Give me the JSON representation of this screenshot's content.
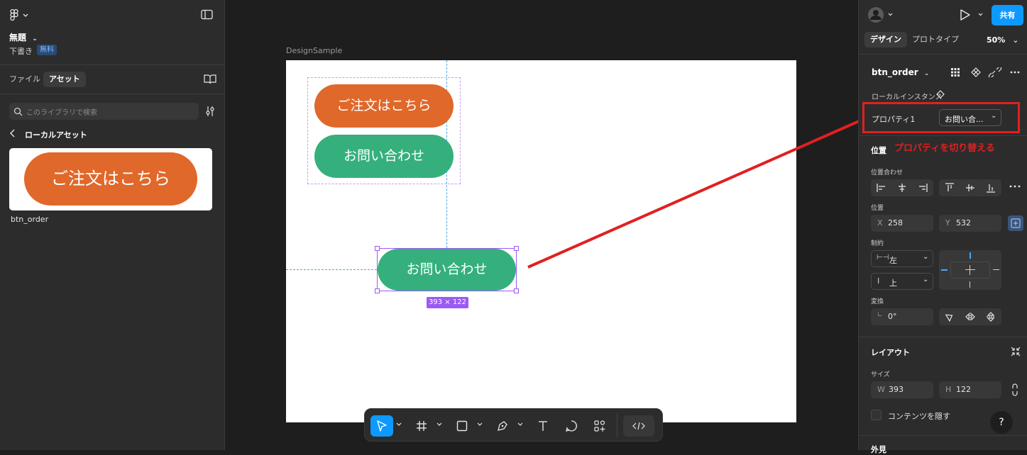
{
  "left_panel": {
    "file_title": "無題",
    "draft_label": "下書き",
    "plan_badge": "無料",
    "tabs": [
      "ファイル",
      "アセット"
    ],
    "search_placeholder": "このライブラリで検索",
    "back_label": "ローカルアセット",
    "asset_preview_text": "ご注文はこちら",
    "asset_name": "btn_order"
  },
  "canvas": {
    "frame_label": "DesignSample",
    "button_order_text": "ご注文はこちら",
    "button_contact_text": "お問い合わせ",
    "selected_button_text": "お問い合わせ",
    "size_badge": "393 × 122"
  },
  "right_panel": {
    "share_label": "共有",
    "tabs": [
      "デザイン",
      "プロトタイプ"
    ],
    "zoom": "50%",
    "component_name": "btn_order",
    "instance_label": "ローカルインスタンス",
    "property_label": "プロパティ1",
    "property_value": "お問い合...",
    "annotation": "プロパティを切り替える",
    "position_section": "位置",
    "alignment_label": "位置合わせ",
    "position_label": "位置",
    "x_label": "X",
    "x_value": "258",
    "y_label": "Y",
    "y_value": "532",
    "constraints_label": "制約",
    "constraint_h": "左",
    "constraint_v": "上",
    "transform_label": "変換",
    "rotation_value": "0°",
    "layout_section": "レイアウト",
    "size_label": "サイズ",
    "w_label": "W",
    "w_value": "393",
    "h_label": "H",
    "h_value": "122",
    "clip_content_label": "コンテンツを隠す",
    "help_label": "?",
    "cutoff_label": "外見"
  },
  "colors": {
    "accent": "#0d99ff",
    "orange": "#e0682a",
    "green": "#35b07d",
    "annotation_red": "#e02020",
    "selection_purple": "#9b59f5"
  }
}
